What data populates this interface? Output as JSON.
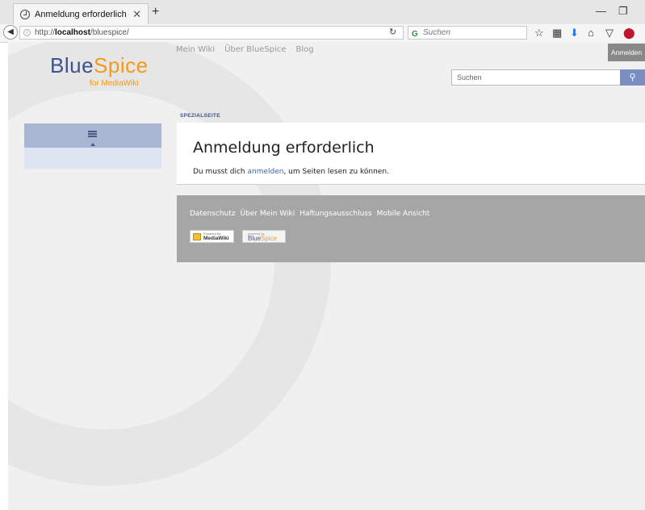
{
  "browser": {
    "tab_title": "Anmeldung erforderlich – ...",
    "tab_close": "✕",
    "new_tab": "+",
    "url_host": "localhost",
    "url_prefix": "http://",
    "url_path": "/bluespice/",
    "search_placeholder": "Suchen",
    "minimize": "—",
    "restore": "❐"
  },
  "wiki": {
    "logo_blue": "Blue",
    "logo_orange": "Spice",
    "logo_sub": "for MediaWiki",
    "nav": [
      "Mein Wiki",
      "Über BlueSpice",
      "Blog"
    ],
    "login_button": "Anmelden",
    "search_placeholder": "Suchen",
    "namespace": "SPEZIALSEITE",
    "heading": "Anmeldung erforderlich",
    "body_pre": "Du musst dich ",
    "body_link": "anmelden",
    "body_post": ", um Seiten lesen zu können.",
    "footer_links": [
      "Datenschutz",
      "Über Mein Wiki",
      "Haftungsausschluss",
      "Mobile Ansicht"
    ],
    "badge_mediawiki_small": "Powered By",
    "badge_mediawiki_big": "MediaWiki",
    "badge_bluespice_small": "powered by",
    "badge_bluespice_blue": "Blue",
    "badge_bluespice_orange": "Spice"
  },
  "colors": {
    "brand_blue": "#3e5389",
    "brand_orange": "#f39a1b",
    "search_button": "#7a8fc0"
  }
}
